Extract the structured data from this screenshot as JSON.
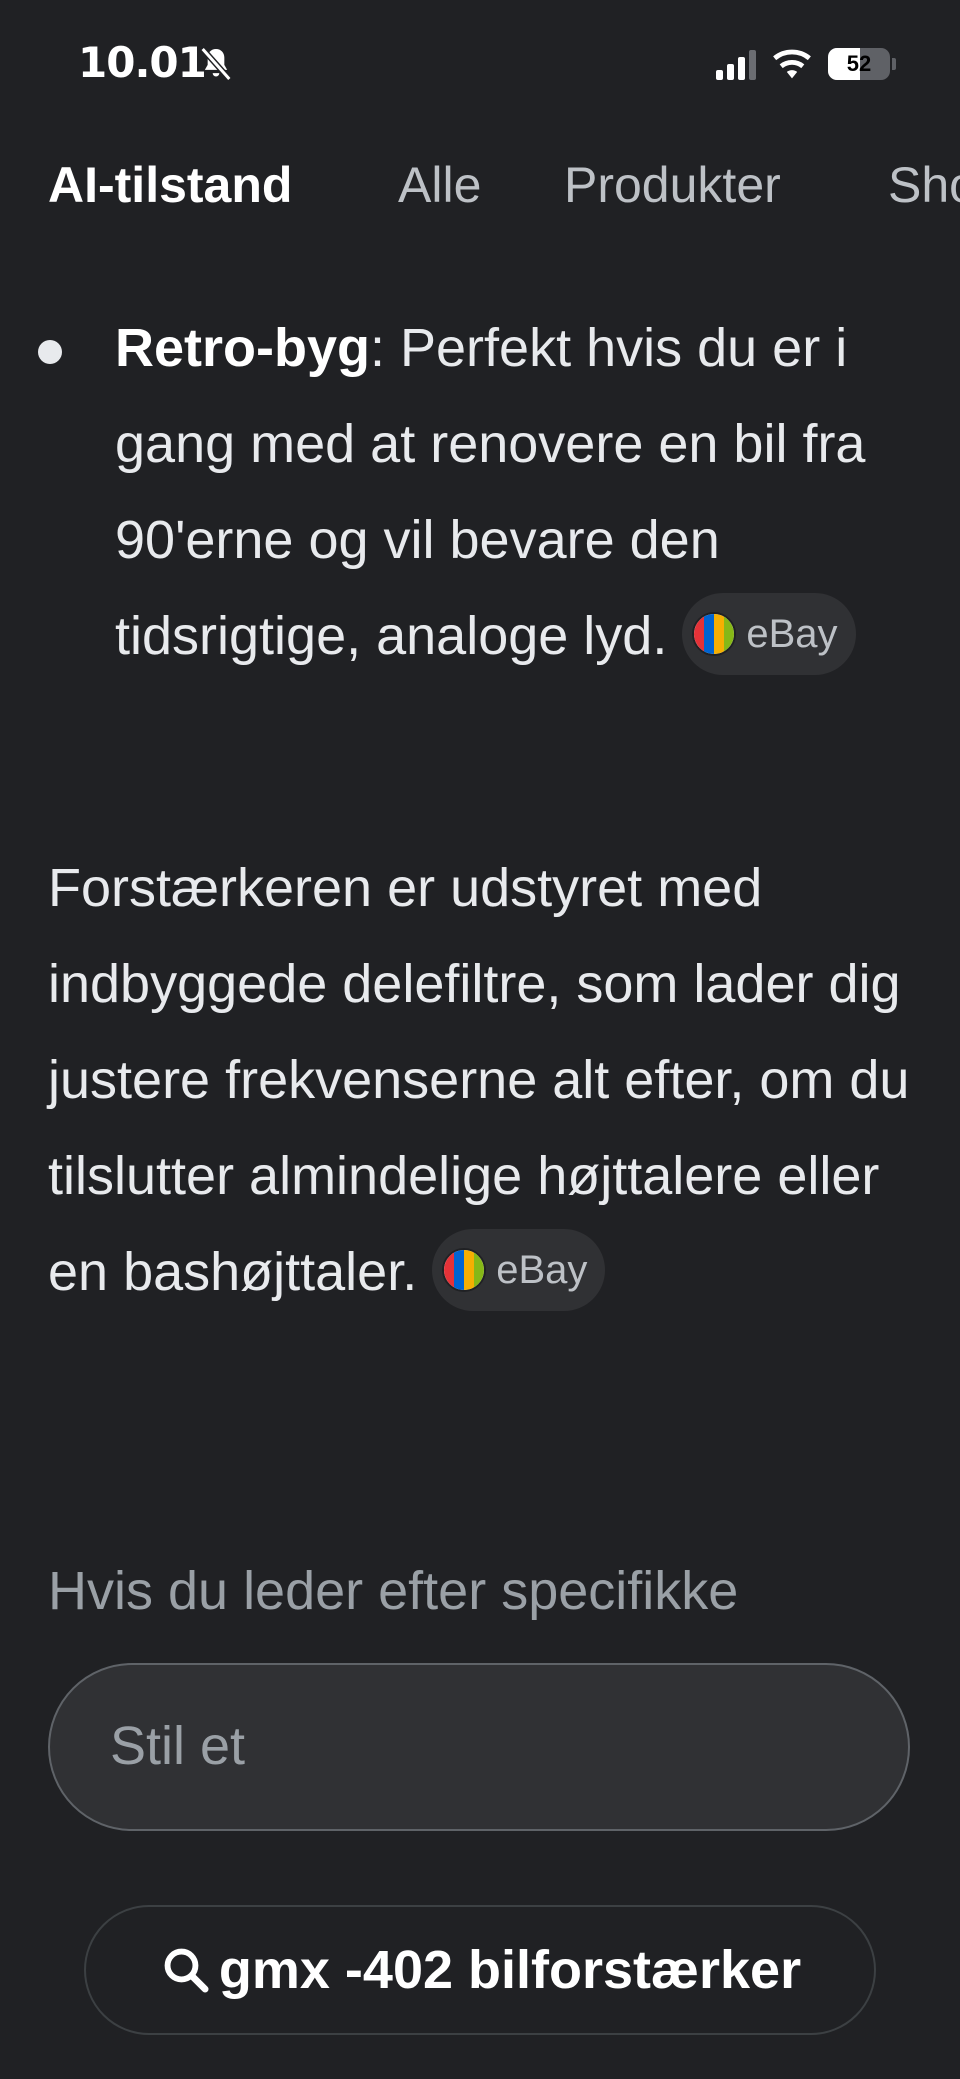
{
  "status_bar": {
    "time": "10.01",
    "battery": "52",
    "battery_level": 0.52
  },
  "tabs": [
    {
      "label": "AI-tilstand",
      "active": true
    },
    {
      "label": "Alle",
      "active": false
    },
    {
      "label": "Produkter",
      "active": false
    },
    {
      "label": "Sho",
      "active": false
    }
  ],
  "content": {
    "bullet": {
      "bold": "Retro-byg",
      "text": ": Perfekt hvis du er i gang med at renovere en bil fra 90'erne og vil bevare den tidsrigtige, analoge lyd."
    },
    "paragraph": "Forstærkeren er udstyret med indbyggede delefiltre, som lader dig justere frekvenserne alt efter, om du tilslutter almindelige højttalere eller en bashøjttaler.",
    "source_chip": "eBay",
    "faded_text": "Hvis du leder efter specifikke"
  },
  "ask": {
    "placeholder": "Stil et"
  },
  "suggestion": {
    "icon": "search-icon",
    "text": "gmx -402 bilforstærker"
  },
  "colors": {
    "background": "#202124",
    "chip": "#303134",
    "text": "#e8eaed",
    "muted": "#9aa0a6"
  }
}
